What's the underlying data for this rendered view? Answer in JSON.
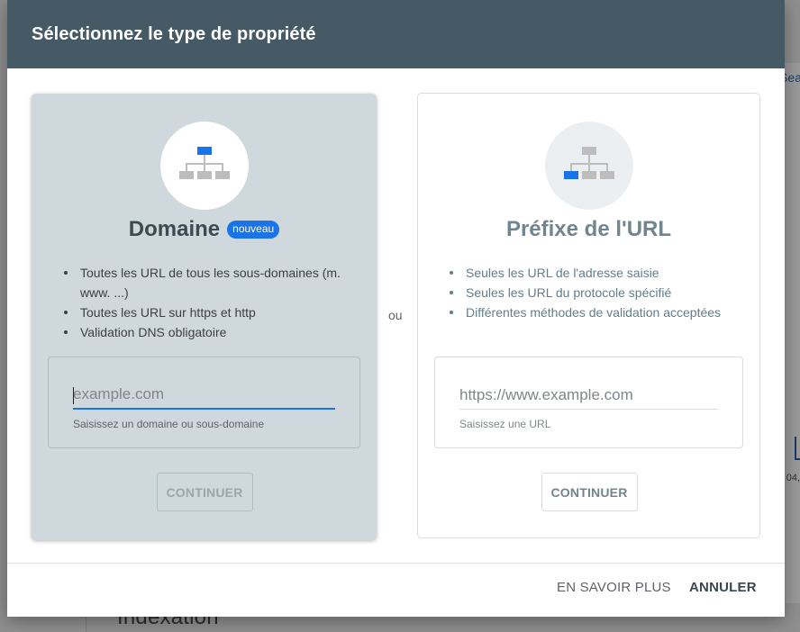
{
  "background": {
    "search_fragment": "Sea",
    "date_fragment": "04,",
    "section_heading": "Indexation"
  },
  "dialog": {
    "title": "Sélectionnez le type de propriété",
    "separator": "ou",
    "domain_card": {
      "title": "Domaine",
      "badge": "nouveau",
      "icon": "sitemap-icon",
      "bullets": [
        "Toutes les URL de tous les sous-domaines (m. www. ...)",
        "Toutes les URL sur https et http",
        "Validation DNS obligatoire"
      ],
      "input": {
        "value": "",
        "placeholder": "example.com",
        "helper": "Saisissez un domaine ou sous-domaine"
      },
      "continue_label": "CONTINUER"
    },
    "url_card": {
      "title": "Préfixe de l'URL",
      "icon": "sitemap-icon",
      "bullets": [
        "Seules les URL de l'adresse saisie",
        "Seules les URL du protocole spécifié",
        "Différentes méthodes de validation acceptées"
      ],
      "input": {
        "value": "",
        "placeholder": "https://www.example.com",
        "helper": "Saisissez une URL"
      },
      "continue_label": "CONTINUER"
    },
    "footer": {
      "learn_more_label": "EN SAVOIR PLUS",
      "cancel_label": "ANNULER"
    }
  },
  "colors": {
    "header_bg": "#455a64",
    "selected_card_bg": "#cfd8dc",
    "accent": "#1a73e8",
    "icon_gray": "#bdbdbd"
  }
}
